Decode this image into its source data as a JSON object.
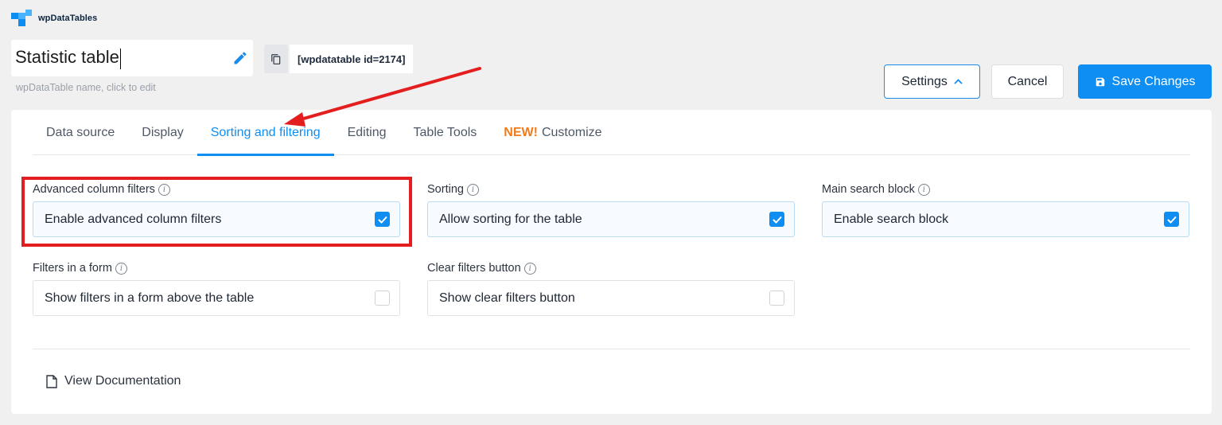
{
  "brand": {
    "name": "wpDataTables"
  },
  "table_name": {
    "value": "Statistic table",
    "hint": "wpDataTable name, click to edit"
  },
  "shortcode": "[wpdatatable id=2174]",
  "buttons": {
    "settings": "Settings",
    "cancel": "Cancel",
    "save": "Save Changes"
  },
  "tabs": [
    {
      "label": "Data source"
    },
    {
      "label": "Display"
    },
    {
      "label": "Sorting and filtering",
      "active": true
    },
    {
      "label": "Editing"
    },
    {
      "label": "Table Tools"
    },
    {
      "badge": "NEW!",
      "label": "Customize"
    }
  ],
  "fields": {
    "advanced_filters": {
      "label": "Advanced column filters",
      "option": "Enable advanced column filters",
      "checked": true
    },
    "sorting": {
      "label": "Sorting",
      "option": "Allow sorting for the table",
      "checked": true
    },
    "main_search": {
      "label": "Main search block",
      "option": "Enable search block",
      "checked": true
    },
    "filters_form": {
      "label": "Filters in a form",
      "option": "Show filters in a form above the table",
      "checked": false
    },
    "clear_filters": {
      "label": "Clear filters button",
      "option": "Show clear filters button",
      "checked": false
    }
  },
  "info_icon_glyph": "i",
  "documentation": {
    "label": "View Documentation"
  },
  "colors": {
    "accent": "#0e8ef2",
    "annotation": "#e41e1e",
    "new_badge": "#f07b1b"
  },
  "icons": [
    "brand-logo-icon",
    "pencil-icon",
    "copy-icon",
    "chevron-up-icon",
    "save-icon",
    "info-icon",
    "checkmark-icon",
    "document-icon"
  ]
}
